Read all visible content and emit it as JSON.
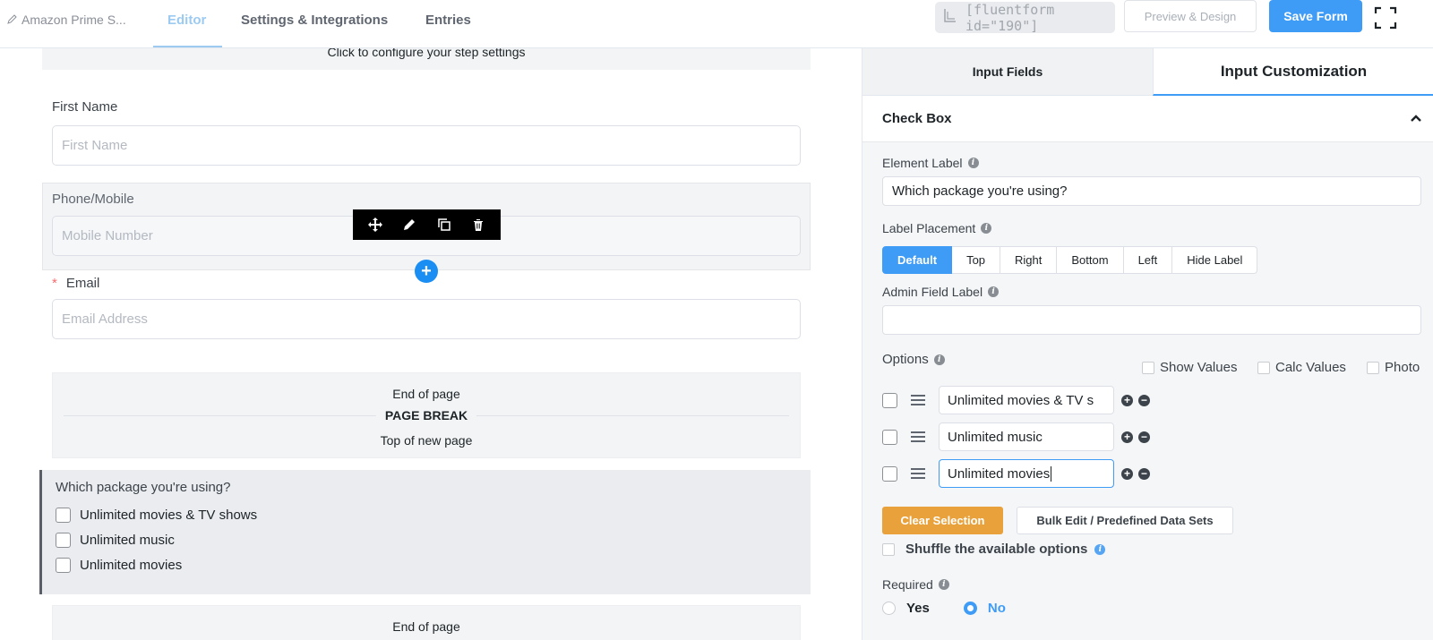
{
  "header": {
    "form_name": "Amazon Prime S...",
    "tabs": [
      {
        "label": "Editor"
      },
      {
        "label": "Settings & Integrations"
      },
      {
        "label": "Entries"
      }
    ],
    "shortcode": "[fluentform id=\"190\"]",
    "preview_label": "Preview & Design",
    "save_label": "Save Form"
  },
  "canvas": {
    "step_settings": "Click to configure your step settings",
    "first_name": {
      "label": "First Name",
      "placeholder": "First Name"
    },
    "phone": {
      "label": "Phone/Mobile",
      "placeholder": "Mobile Number"
    },
    "email": {
      "required_mark": "*",
      "label": "Email",
      "placeholder": "Email Address"
    },
    "page_break": {
      "end": "End of page",
      "title": "PAGE BREAK",
      "top": "Top of new page"
    },
    "checkbox_field": {
      "question": "Which package you're using?",
      "options": [
        "Unlimited movies & TV shows",
        "Unlimited music",
        "Unlimited movies"
      ]
    },
    "page_break_2": {
      "end": "End of page"
    }
  },
  "panel": {
    "tabs": [
      {
        "label": "Input Fields"
      },
      {
        "label": "Input Customization"
      }
    ],
    "section_title": "Check Box",
    "element_label": {
      "label": "Element Label",
      "value": "Which package you're using?"
    },
    "label_placement": {
      "label": "Label Placement",
      "options": [
        "Default",
        "Top",
        "Right",
        "Bottom",
        "Left",
        "Hide Label"
      ],
      "selected": "Default"
    },
    "admin_field_label": {
      "label": "Admin Field Label",
      "value": ""
    },
    "options": {
      "label": "Options",
      "toggles": [
        "Show Values",
        "Calc Values",
        "Photo"
      ],
      "items": [
        "Unlimited movies & TV s",
        "Unlimited music",
        "Unlimited movies"
      ]
    },
    "clear_selection": "Clear Selection",
    "bulk_edit": "Bulk Edit / Predefined Data Sets",
    "shuffle": "Shuffle the available options",
    "required": {
      "label": "Required",
      "yes": "Yes",
      "no": "No",
      "selected": "No"
    }
  },
  "colors": {
    "primary": "#3f9cf6",
    "warning": "#e9a23b",
    "danger": "#f56c6c"
  }
}
